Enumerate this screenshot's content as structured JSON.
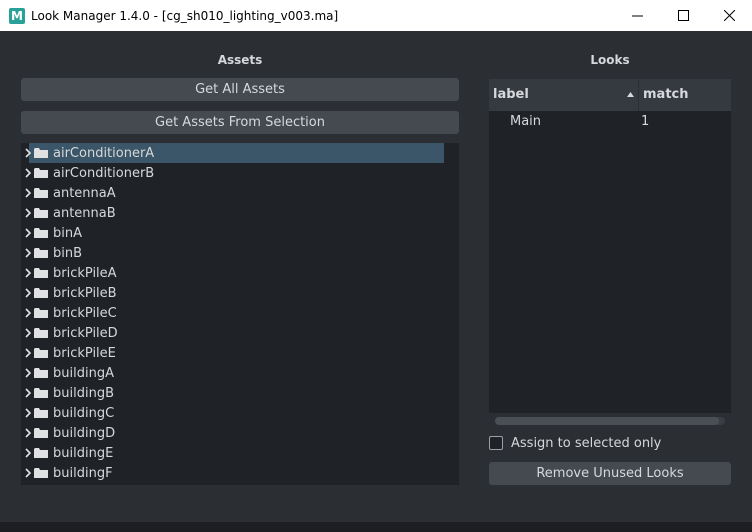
{
  "window": {
    "icon_letter": "M",
    "title": "Look Manager 1.4.0 - [cg_sh010_lighting_v003.ma]"
  },
  "assets": {
    "title": "Assets",
    "get_all_label": "Get All Assets",
    "get_selection_label": "Get Assets From Selection",
    "items": [
      "airConditionerA",
      "airConditionerB",
      "antennaA",
      "antennaB",
      "binA",
      "binB",
      "brickPileA",
      "brickPileB",
      "brickPileC",
      "brickPileD",
      "brickPileE",
      "buildingA",
      "buildingB",
      "buildingC",
      "buildingD",
      "buildingE",
      "buildingF"
    ],
    "selected_index": 0
  },
  "looks": {
    "title": "Looks",
    "columns": [
      "label",
      "match"
    ],
    "rows": [
      {
        "label": "Main",
        "match": "1"
      }
    ],
    "assign_checkbox_label": "Assign to selected only",
    "assign_checked": false,
    "remove_unused_label": "Remove Unused Looks"
  },
  "colors": {
    "background": "#2b2e33",
    "panel": "#1f2227",
    "button": "#454a51",
    "selection": "#3b5668"
  }
}
